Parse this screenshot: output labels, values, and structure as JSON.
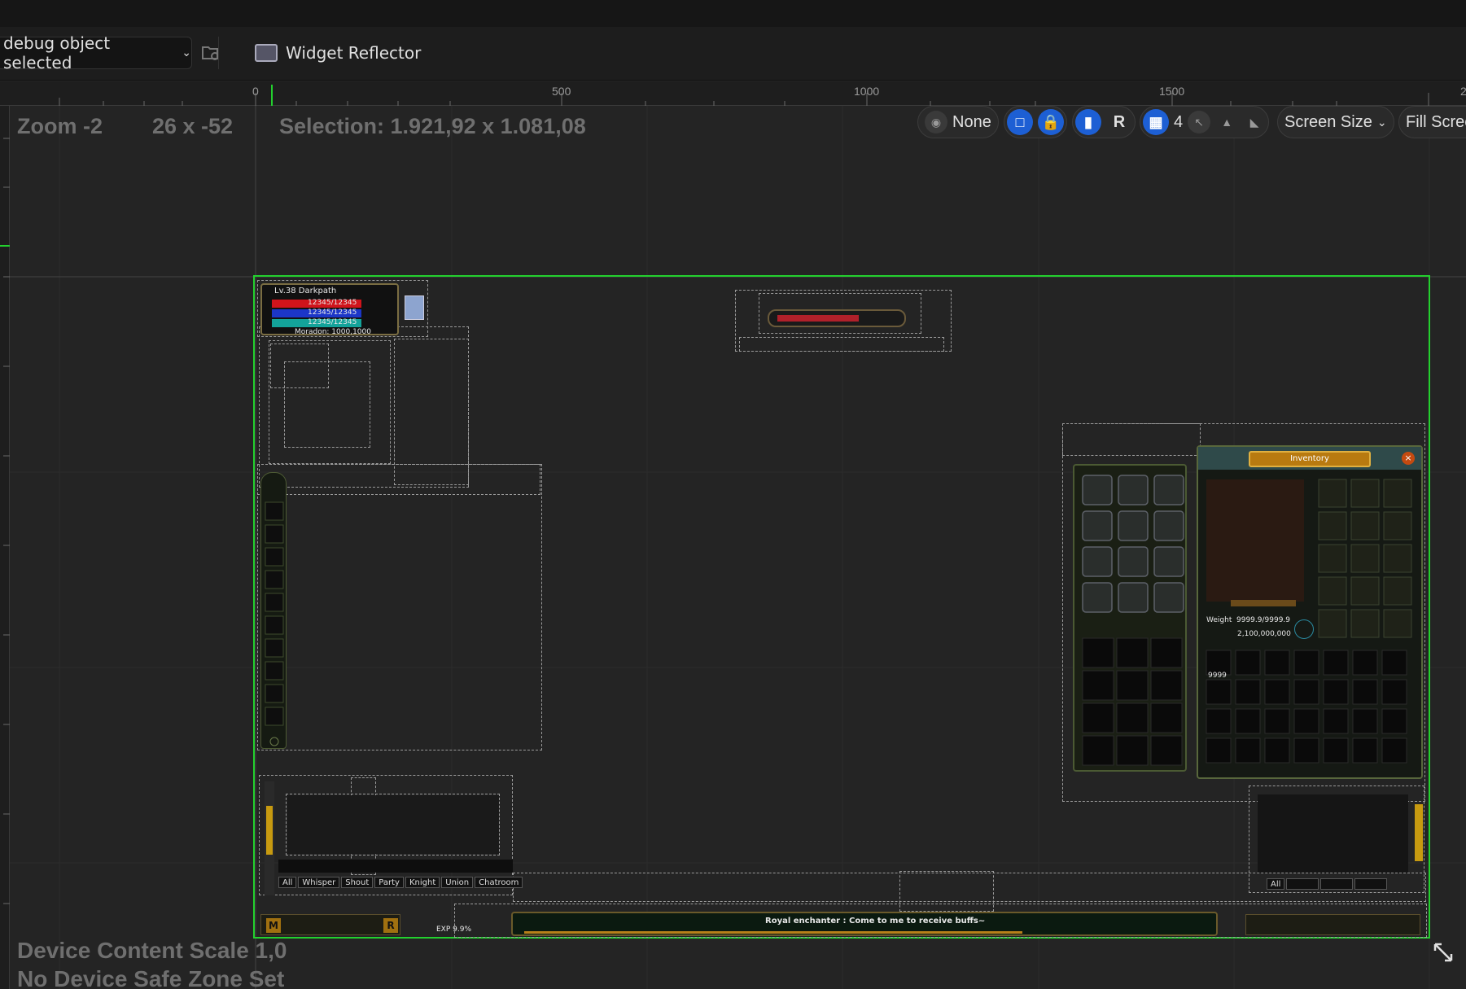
{
  "toolbar": {
    "debug_dropdown": "debug object selected",
    "widget_reflector": "Widget Reflector"
  },
  "ruler": {
    "labels": [
      "0",
      "500",
      "1000",
      "1500",
      "2"
    ]
  },
  "canvas_info": {
    "zoom": "Zoom -2",
    "size": "26 x -52",
    "selection": "Selection: 1.921,92 x 1.081,08",
    "device_scale": "Device Content Scale 1,0",
    "safe_zone": "No Device Safe Zone Set"
  },
  "viewport_tools": {
    "preview_none": "None",
    "r_label": "R",
    "grid_value": "4",
    "screen_size": "Screen Size",
    "fill_screen": "Fill Scree"
  },
  "game_ui": {
    "player_name": "Lv.38 Darkpath",
    "hp": "12345/12345",
    "mp": "12345/12345",
    "sp": "12345/12345",
    "location": "Moradon: 1000,1000",
    "inventory_title": "Inventory",
    "weight_label": "Weight",
    "weight_value": "9999.9/9999.9",
    "gold": "2,100,000,000",
    "stack_count": "9999",
    "chat_tabs": [
      "All",
      "Whisper",
      "Shout",
      "Party",
      "Knight",
      "Union",
      "Chatroom"
    ],
    "right_chat_tab": "All",
    "notice": "Royal enchanter : Come to me to receive buffs~",
    "exp": "EXP 9.9%",
    "menu_letters": [
      "M",
      "R"
    ]
  },
  "colors": {
    "selection_outline": "#23d02e",
    "accent_blue": "#1d5fd4",
    "hp": "#d0141b",
    "mp": "#1c36c8",
    "sp": "#13a39a"
  }
}
